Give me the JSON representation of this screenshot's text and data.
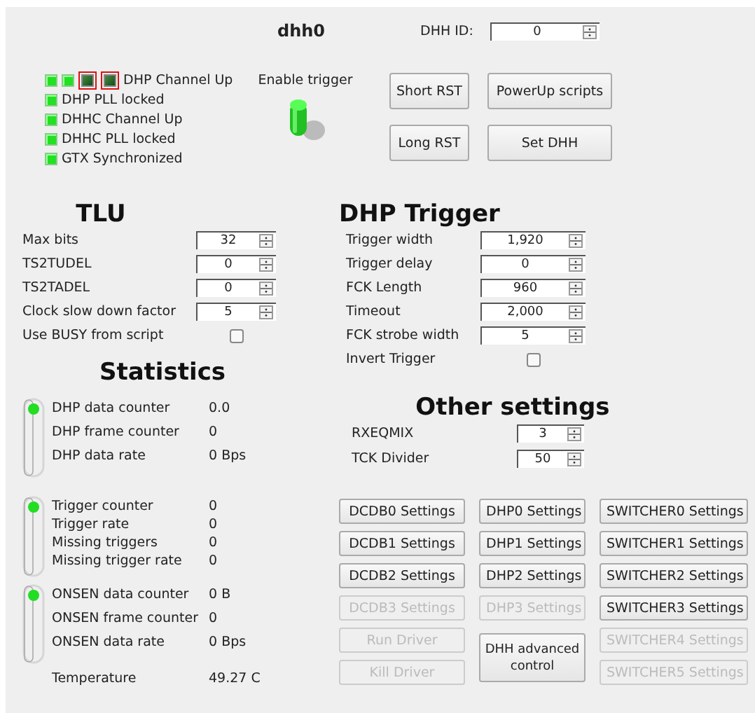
{
  "title": "dhh0",
  "dhh_id": {
    "label": "DHH ID:",
    "value": "0"
  },
  "dhp_channels": {
    "label": "DHP Channel Up",
    "leds": [
      {
        "on": true,
        "error": false
      },
      {
        "on": true,
        "error": false
      },
      {
        "on": false,
        "error": true
      },
      {
        "on": false,
        "error": true
      }
    ]
  },
  "status_indicators": [
    {
      "label": "DHP PLL locked",
      "on": true
    },
    {
      "label": "DHHC Channel Up",
      "on": true
    },
    {
      "label": "DHHC PLL locked",
      "on": true
    },
    {
      "label": "GTX Synchronized",
      "on": true
    }
  ],
  "enable_trigger": {
    "label": "Enable trigger",
    "on": true
  },
  "top_buttons": [
    {
      "label": "Short RST"
    },
    {
      "label": "PowerUp scripts"
    },
    {
      "label": "Long RST"
    },
    {
      "label": "Set DHH"
    }
  ],
  "tlu": {
    "title": "TLU",
    "fields": [
      {
        "kind": "spin",
        "label": "Max bits",
        "value": "32"
      },
      {
        "kind": "spin",
        "label": "TS2TUDEL",
        "value": "0"
      },
      {
        "kind": "spin",
        "label": "TS2TADEL",
        "value": "0"
      },
      {
        "kind": "spin",
        "label": "Clock slow down factor",
        "value": "5"
      },
      {
        "kind": "check",
        "label": "Use BUSY from script",
        "checked": false
      }
    ]
  },
  "statistics": {
    "title": "Statistics",
    "groups": [
      {
        "led_on": true,
        "rows": [
          {
            "label": "DHP data counter",
            "value": "0.0"
          },
          {
            "label": "DHP frame counter",
            "value": "0"
          },
          {
            "label": "DHP data rate",
            "value": "0 Bps"
          }
        ]
      },
      {
        "led_on": true,
        "rows": [
          {
            "label": "Trigger counter",
            "value": "0"
          },
          {
            "label": "Trigger rate",
            "value": "0"
          },
          {
            "label": "Missing triggers",
            "value": "0"
          },
          {
            "label": "Missing trigger rate",
            "value": "0"
          }
        ]
      },
      {
        "led_on": true,
        "rows": [
          {
            "label": "ONSEN data counter",
            "value": "0 B"
          },
          {
            "label": "ONSEN frame counter",
            "value": "0"
          },
          {
            "label": "ONSEN data rate",
            "value": "0 Bps"
          }
        ]
      }
    ],
    "temperature": {
      "label": "Temperature",
      "value": "49.27 C"
    }
  },
  "dhp_trigger": {
    "title": "DHP Trigger",
    "fields": [
      {
        "kind": "spin",
        "label": "Trigger width",
        "value": "1,920"
      },
      {
        "kind": "spin",
        "label": "Trigger delay",
        "value": "0"
      },
      {
        "kind": "spin",
        "label": "FCK Length",
        "value": "960"
      },
      {
        "kind": "spin",
        "label": "Timeout",
        "value": "2,000"
      },
      {
        "kind": "spin",
        "label": "FCK strobe width",
        "value": "5"
      },
      {
        "kind": "check",
        "label": "Invert Trigger",
        "checked": false
      }
    ]
  },
  "other_settings": {
    "title": "Other settings",
    "fields": [
      {
        "kind": "spin",
        "label": "RXEQMIX",
        "value": "3"
      },
      {
        "kind": "spin",
        "label": "TCK Divider",
        "value": "50"
      }
    ]
  },
  "button_columns": [
    [
      {
        "label": "DCDB0 Settings",
        "disabled": false
      },
      {
        "label": "DCDB1 Settings",
        "disabled": false
      },
      {
        "label": "DCDB2 Settings",
        "disabled": false
      },
      {
        "label": "DCDB3 Settings",
        "disabled": true
      },
      {
        "label": "Run Driver",
        "disabled": true
      },
      {
        "label": "Kill Driver",
        "disabled": true
      }
    ],
    [
      {
        "label": "DHP0 Settings",
        "disabled": false
      },
      {
        "label": "DHP1 Settings",
        "disabled": false
      },
      {
        "label": "DHP2 Settings",
        "disabled": false
      },
      {
        "label": "DHP3 Settings",
        "disabled": true
      },
      {
        "label": "DHH advanced control",
        "disabled": false,
        "kind": "tall"
      }
    ],
    [
      {
        "label": "SWITCHER0 Settings",
        "disabled": false
      },
      {
        "label": "SWITCHER1 Settings",
        "disabled": false
      },
      {
        "label": "SWITCHER2 Settings",
        "disabled": false
      },
      {
        "label": "SWITCHER3 Settings",
        "disabled": false
      },
      {
        "label": "SWITCHER4 Settings",
        "disabled": true
      },
      {
        "label": "SWITCHER5 Settings",
        "disabled": true
      }
    ]
  ]
}
